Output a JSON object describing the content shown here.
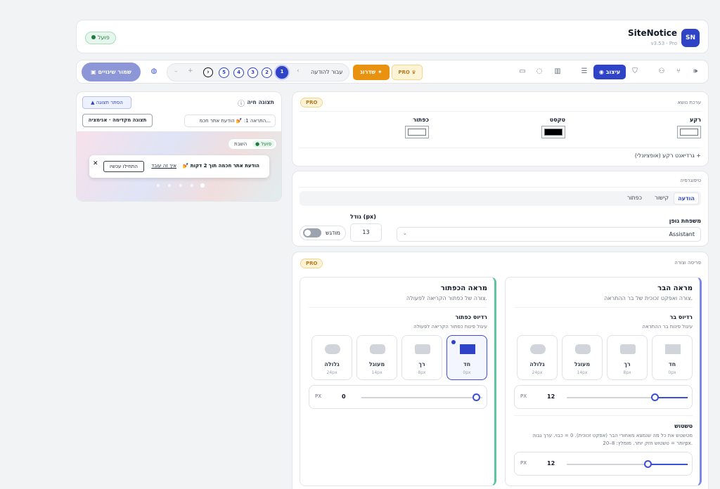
{
  "app": {
    "logo": "SN",
    "name": "SiteNotice",
    "version": "v3.53 · Pro",
    "status": "פועל"
  },
  "toolbar": {
    "save_label": "שמור שינויים",
    "nav": {
      "prev": "–",
      "next": "+",
      "chevron": "›",
      "goto_label": "עבור להודעה",
      "chevron_back": "‹",
      "pages": [
        "5",
        "4",
        "3",
        "2",
        "1"
      ]
    },
    "upgrade_label": "שדרוג",
    "pro_label": "PRO",
    "design_label": "עיצוב"
  },
  "theme": {
    "title": "ערכת נושא",
    "pro": "PRO",
    "background_label": "רקע",
    "text_label": "טקסט",
    "button_label": "כפתור",
    "colors": {
      "background": "#ffffff",
      "text": "#000000",
      "button": "#ffffff"
    },
    "gradient_label": "גרדיאנט רקע (אופציונלי)",
    "plus": "+"
  },
  "typography": {
    "title": "טיפוגרפיה",
    "tabs": [
      "הודעה",
      "קישור",
      "כפתור"
    ],
    "font_family_label": "משפחת גופן",
    "font_family_value": "Assistant",
    "size_label": "גודל (px)",
    "size_value": "13",
    "bold_label": "מודגש"
  },
  "layout": {
    "title": "פריסה וצורה",
    "pro": "PRO",
    "bar": {
      "heading": "מראה הבר",
      "desc": "צורה ואפקט זכוכית של בר ההתראה.",
      "radius_title": "רדיוס בר",
      "radius_desc": "עיגול פינות בר ההתראה",
      "options": [
        {
          "label": "חד",
          "value": "0px"
        },
        {
          "label": "רך",
          "value": "8px"
        },
        {
          "label": "מעוגל",
          "value": "14px"
        },
        {
          "label": "גלולה",
          "value": "24px"
        }
      ],
      "slider_value": "12",
      "unit": "PX",
      "blur_title": "טשטוש",
      "blur_desc_1": "מטשטש את כל מה שנמצא מאחורי הבר (אפקט זכוכית). 0 = כבוי. ערך גבוה",
      "blur_desc_2": "יותר = טשטוש חזק יותר. מומלץ: 8–20px.",
      "blur_value": "12",
      "blur_fraction": 0.82,
      "radius_fraction": 0.5
    },
    "button": {
      "heading": "מראה הכפתור",
      "desc": "צורה של כפתור הקריאה לפעולה.",
      "radius_title": "רדיוס כפתור",
      "radius_desc": "עיגול פינות כפתור הקריאה לפעולה",
      "options": [
        {
          "label": "חד",
          "value": "0px"
        },
        {
          "label": "רך",
          "value": "8px"
        },
        {
          "label": "מעוגל",
          "value": "14px"
        },
        {
          "label": "גלולה",
          "value": "24px"
        }
      ],
      "slider_value": "0",
      "unit": "PX",
      "slider_fraction": 1.0
    }
  },
  "preview": {
    "title": "תצוגה חיה",
    "info": "ⓘ",
    "hide_label": "הסתר תצוגה",
    "select_value": "התראה 1: 💅 הודעת אתר חכמ...",
    "animate_label": "תצוגה מקדימה · אנימציה",
    "toggle_on": "פועל",
    "toggle_off": "השבת",
    "notice_text": "💅 הודעת אתר חכמה תוך 2 דקות",
    "link_text": "איך זה עובד",
    "cta_label": "התחילו עכשיו",
    "close": "✕"
  }
}
